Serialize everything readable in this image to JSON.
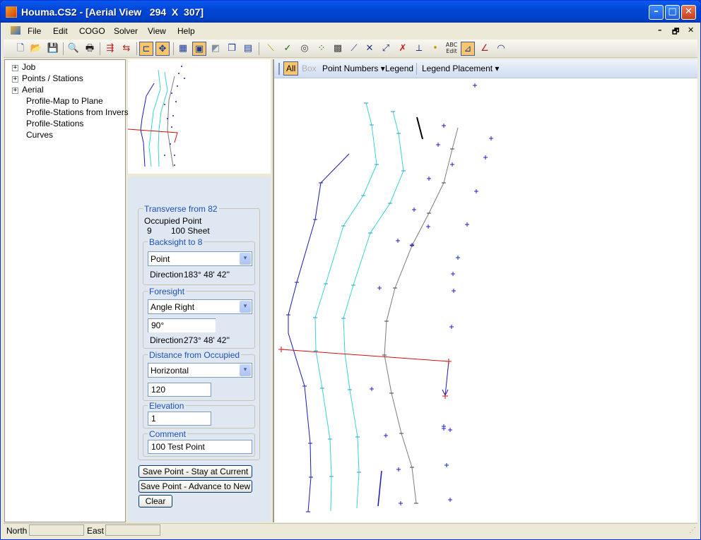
{
  "window": {
    "title": "Houma.CS2 - [Aerial View   294  X  307]",
    "minimize_glyph": "–",
    "maximize_glyph": "□",
    "close_glyph": "✕"
  },
  "menu": {
    "items": [
      "File",
      "Edit",
      "COGO",
      "Solver",
      "View",
      "Help"
    ],
    "mdi_minimize": "–",
    "mdi_restore": "🗗",
    "mdi_close": "✕"
  },
  "tree": {
    "nodes": [
      {
        "label": "Job",
        "expandable": true
      },
      {
        "label": "Points / Stations",
        "expandable": true
      },
      {
        "label": "Aerial",
        "expandable": true
      },
      {
        "label": "Profile-Map to Plane",
        "expandable": false
      },
      {
        "label": "Profile-Stations from Inverse",
        "expandable": false
      },
      {
        "label": "Profile-Stations",
        "expandable": false
      },
      {
        "label": "Curves",
        "expandable": false
      }
    ],
    "expander_glyph": "+"
  },
  "traverse": {
    "group_title": "Transverse from 82",
    "occupied_label": "Occupied Point",
    "occupied_number": "9",
    "occupied_name": "100 Sheet",
    "backsight": {
      "title": "Backsight to 8",
      "type": "Point",
      "direction_label": "Direction",
      "direction": "183° 48' 42''"
    },
    "foresight": {
      "title": "Foresight",
      "type": "Angle Right",
      "angle": "90°",
      "direction_label": "Direction",
      "direction": "273° 48' 42''"
    },
    "distance": {
      "title": "Distance from Occupied",
      "type": "Horizontal",
      "value": "120"
    },
    "elevation": {
      "title": "Elevation",
      "value": "1"
    },
    "comment": {
      "title": "Comment",
      "value": "100 Test Point"
    },
    "buttons": {
      "save_stay": "Save Point - Stay at Current",
      "save_advance": "Save Point - Advance to New",
      "clear": "Clear"
    }
  },
  "map_toolbar": {
    "all": "All",
    "box": "Box",
    "point_numbers": "Point Numbers",
    "legend": "Legend",
    "legend_placement": "Legend Placement",
    "dropdown_glyph": "▾"
  },
  "status": {
    "north_label": "North",
    "north_value": "",
    "east_label": "East",
    "east_value": ""
  },
  "colors": {
    "line_blue": "#1a1ab4",
    "line_cyan": "#3cd2d2",
    "line_gray": "#7a7a7a",
    "line_red": "#d01010",
    "point_blue": "#2020c8",
    "accent_orange": "#f7c56a"
  },
  "icons": {
    "tools": [
      "new-icon",
      "open-icon",
      "save-icon",
      "print-preview-icon",
      "print-icon",
      "import-icon",
      "export-icon",
      "tree-icon",
      "zoom-extents-icon",
      "grid-icon",
      "window-icon",
      "layer-icon",
      "copy-icon",
      "panel-icon",
      "line-icon",
      "check-icon",
      "target-icon",
      "dots-icon",
      "table-icon",
      "polyline-icon",
      "intersect-icon",
      "offset-icon",
      "cross-icon",
      "perpendicular-icon",
      "point-icon",
      "abc-edit-icon",
      "traverse-icon",
      "angle-icon",
      "arc-icon"
    ]
  }
}
